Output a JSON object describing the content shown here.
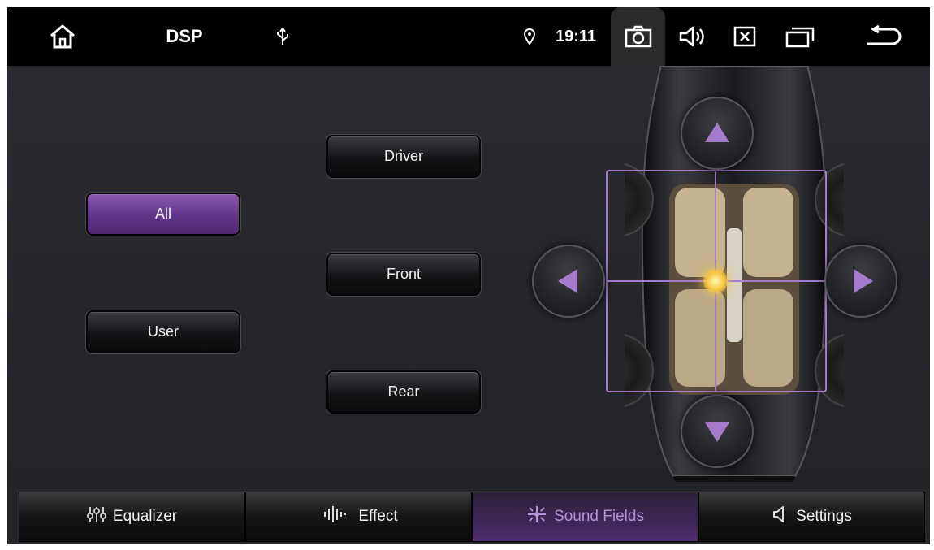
{
  "statusbar": {
    "title": "DSP",
    "time": "19:11",
    "icons": [
      "home-icon",
      "usb-icon",
      "location-icon",
      "camera-icon",
      "volume-icon",
      "close-box-icon",
      "recent-apps-icon",
      "back-icon"
    ]
  },
  "left_buttons": {
    "all_label": "All",
    "user_label": "User",
    "selected": "All"
  },
  "zone_buttons": {
    "driver_label": "Driver",
    "front_label": "Front",
    "rear_label": "Rear"
  },
  "sound_field": {
    "arrows": [
      "up",
      "left",
      "right",
      "down"
    ],
    "accent_color": "#a57bcc",
    "focus_color": "#f5c542"
  },
  "tabs": [
    {
      "label": "Equalizer",
      "icon": "equalizer-sliders-icon"
    },
    {
      "label": "Effect",
      "icon": "waveform-icon"
    },
    {
      "label": "Sound Fields",
      "icon": "sound-fields-icon",
      "active": true
    },
    {
      "label": "Settings",
      "icon": "speaker-icon"
    }
  ]
}
